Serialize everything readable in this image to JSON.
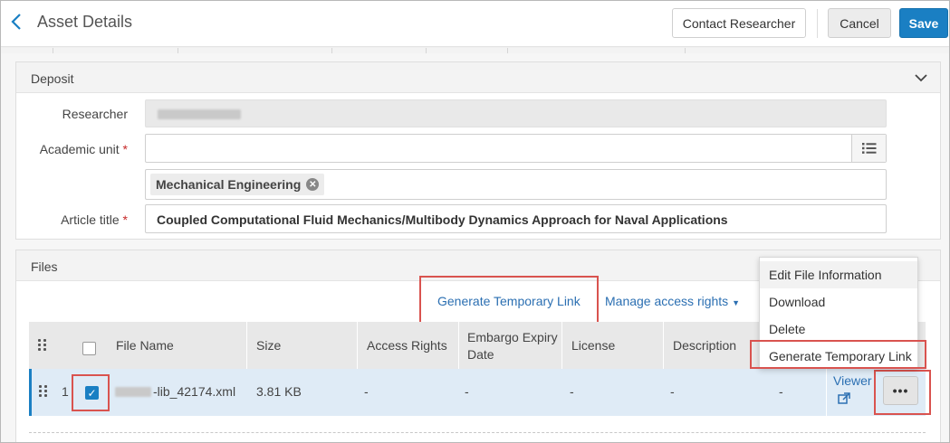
{
  "header": {
    "title": "Asset Details",
    "contact_label": "Contact Researcher",
    "cancel_label": "Cancel",
    "save_label": "Save"
  },
  "deposit": {
    "title": "Deposit",
    "researcher_label": "Researcher",
    "academic_unit_label": "Academic unit",
    "academic_unit_chip": "Mechanical Engineering",
    "article_title_label": "Article title",
    "article_title_value": "Coupled Computational Fluid Mechanics/Multibody Dynamics Approach for Naval Applications",
    "required_marker": "*"
  },
  "files": {
    "title": "Files",
    "generate_link_label": "Generate Temporary Link",
    "manage_access_label": "Manage access rights",
    "columns": [
      "File Name",
      "Size",
      "Access Rights",
      "Embargo Expiry Date",
      "License",
      "Description"
    ],
    "row": {
      "index": "1",
      "file_name": "-lib_42174.xml",
      "size": "3.81 KB",
      "access_rights": "-",
      "embargo": "-",
      "license": "-",
      "description": "-",
      "extra": "-",
      "viewer_label": "Viewer"
    }
  },
  "menu": {
    "items": [
      "Edit File Information",
      "Download",
      "Delete",
      "Generate Temporary Link"
    ]
  },
  "colors": {
    "accent": "#1a7fc3",
    "link": "#2b6fb2",
    "highlight": "#d9534f",
    "selected_row": "#dfebf6"
  }
}
